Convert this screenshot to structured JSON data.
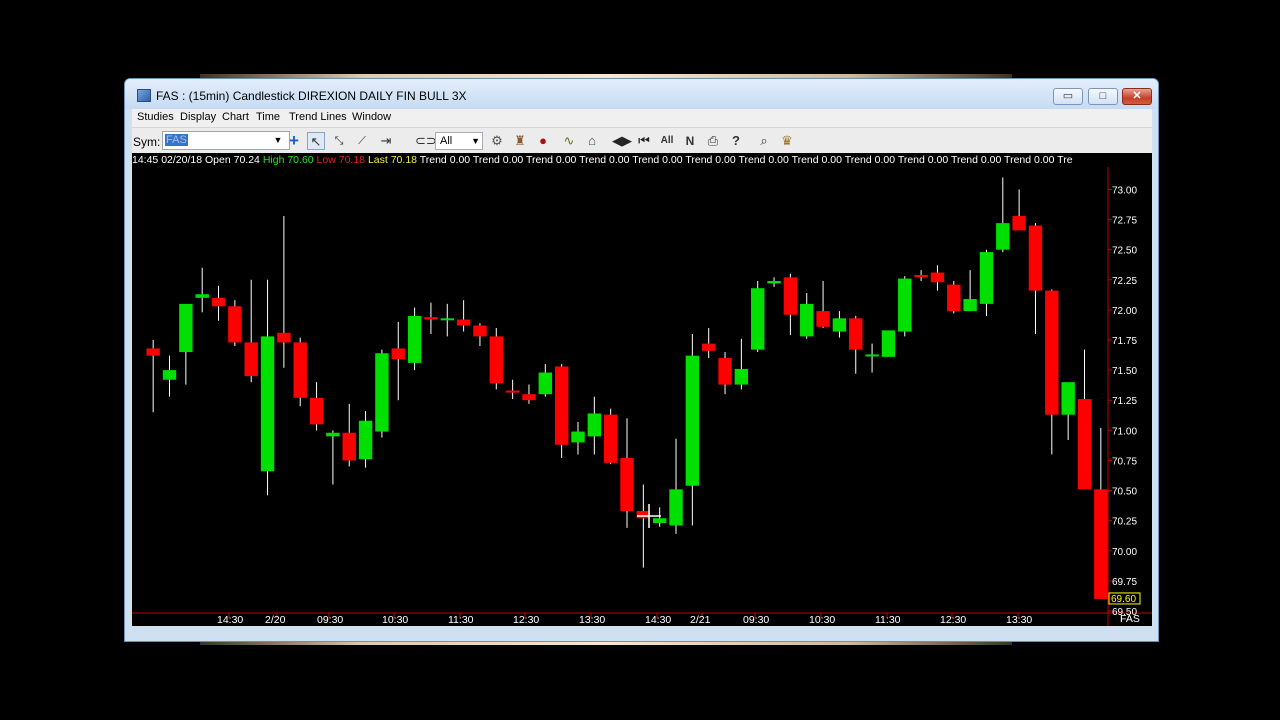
{
  "window": {
    "title": "FAS : (15min) Candlestick  DIREXION DAILY FIN BULL 3X",
    "min_glyph": "▭",
    "max_glyph": "□",
    "close_glyph": "✕"
  },
  "menu": [
    "Studies",
    "Display",
    "Chart",
    "Time",
    "Trend Lines",
    "Window"
  ],
  "toolbar": {
    "sym_label": "Sym:",
    "sym_value": "FAS",
    "range_value": "All",
    "icons": [
      "plus-icon",
      "pointer-icon",
      "crosshair-tool-icon",
      "line-tool-icon",
      "measure-icon",
      "link-icon",
      "gear-icon",
      "stamp-icon",
      "record-icon",
      "wave-icon",
      "building-icon",
      "scroll-left-right-icon",
      "skip-icon",
      "all-text-icon",
      "n-icon",
      "printer-icon",
      "help-icon",
      "search-icon",
      "bag-icon"
    ]
  },
  "status": {
    "time": "14:45",
    "date": "02/20/18",
    "open_label": "Open",
    "open": "70.24",
    "high_label": "High",
    "high": "70.60",
    "low_label": "Low",
    "low": "70.18",
    "last_label": "Last",
    "last": "70.18",
    "trend_text": "Trend 0.00 Trend 0.00 Trend 0.00 Trend 0.00 Trend 0.00 Trend 0.00 Trend 0.00 Trend 0.00 Trend 0.00 Trend 0.00 Trend 0.00 Trend 0.00 Tre"
  },
  "colors": {
    "up": "#00e000",
    "down": "#ff0000",
    "grid": "#c00000",
    "axis_text": "#ffffff",
    "last_box": "#ffff00"
  },
  "chart_data": {
    "type": "candlestick",
    "symbol": "FAS",
    "interval": "15min",
    "ylim": [
      69.5,
      73.12
    ],
    "y_ticks": [
      "73.00",
      "72.75",
      "72.50",
      "72.25",
      "72.00",
      "71.75",
      "71.50",
      "71.25",
      "71.00",
      "70.75",
      "70.50",
      "70.25",
      "70.00",
      "69.75",
      "69.50"
    ],
    "last_price_label": "69.60",
    "x_labels": [
      "14:30",
      "2/20",
      "09:30",
      "10:30",
      "11:30",
      "12:30",
      "13:30",
      "14:30",
      "2/21",
      "09:30",
      "10:30",
      "11:30",
      "12:30",
      "13:30"
    ],
    "axis_symbol": "FAS",
    "candles": [
      [
        71.68,
        71.75,
        71.15,
        71.62
      ],
      [
        71.42,
        71.62,
        71.28,
        71.5
      ],
      [
        71.65,
        71.84,
        71.38,
        72.05
      ],
      [
        72.1,
        72.35,
        71.98,
        72.13
      ],
      [
        72.1,
        72.2,
        71.91,
        72.03
      ],
      [
        72.03,
        72.08,
        71.7,
        71.73
      ],
      [
        71.73,
        72.25,
        71.4,
        71.45
      ],
      [
        70.66,
        72.25,
        70.46,
        71.78
      ],
      [
        71.81,
        72.78,
        71.52,
        71.73
      ],
      [
        71.73,
        71.77,
        71.2,
        71.27
      ],
      [
        71.27,
        71.4,
        71.0,
        71.05
      ],
      [
        70.95,
        71.0,
        70.55,
        70.98
      ],
      [
        70.98,
        71.22,
        70.7,
        70.75
      ],
      [
        70.76,
        71.16,
        70.69,
        71.08
      ],
      [
        70.99,
        71.67,
        70.94,
        71.64
      ],
      [
        71.68,
        71.9,
        71.25,
        71.59
      ],
      [
        71.56,
        72.02,
        71.5,
        71.95
      ],
      [
        71.94,
        72.06,
        71.8,
        71.92
      ],
      [
        71.92,
        72.05,
        71.78,
        71.93
      ],
      [
        71.92,
        72.08,
        71.82,
        71.87
      ],
      [
        71.87,
        71.89,
        71.7,
        71.78
      ],
      [
        71.78,
        71.85,
        71.34,
        71.39
      ],
      [
        71.33,
        71.42,
        71.26,
        71.32
      ],
      [
        71.3,
        71.38,
        71.22,
        71.25
      ],
      [
        71.3,
        71.55,
        71.28,
        71.48
      ],
      [
        71.53,
        71.55,
        70.77,
        70.88
      ],
      [
        70.9,
        71.07,
        70.8,
        70.99
      ],
      [
        70.95,
        71.28,
        70.8,
        71.14
      ],
      [
        71.13,
        71.18,
        70.72,
        70.73
      ],
      [
        70.77,
        71.1,
        70.19,
        70.33
      ],
      [
        70.33,
        70.55,
        69.86,
        70.27
      ],
      [
        70.23,
        70.36,
        70.2,
        70.27
      ],
      [
        70.21,
        70.93,
        70.14,
        70.51
      ],
      [
        70.54,
        71.8,
        70.21,
        71.62
      ],
      [
        71.72,
        71.85,
        71.6,
        71.66
      ],
      [
        71.6,
        71.65,
        71.3,
        71.38
      ],
      [
        71.38,
        71.76,
        71.34,
        71.51
      ],
      [
        71.67,
        72.24,
        71.65,
        72.18
      ],
      [
        72.22,
        72.27,
        72.19,
        72.24
      ],
      [
        72.27,
        72.3,
        71.79,
        71.96
      ],
      [
        71.78,
        72.14,
        71.76,
        72.05
      ],
      [
        71.99,
        72.24,
        71.85,
        71.86
      ],
      [
        71.82,
        71.99,
        71.77,
        71.93
      ],
      [
        71.93,
        71.95,
        71.47,
        71.67
      ],
      [
        71.62,
        71.72,
        71.48,
        71.63
      ],
      [
        71.61,
        71.77,
        71.62,
        71.83
      ],
      [
        71.82,
        72.28,
        71.78,
        72.26
      ],
      [
        72.29,
        72.33,
        72.24,
        72.27
      ],
      [
        72.31,
        72.37,
        72.16,
        72.23
      ],
      [
        72.21,
        72.24,
        71.97,
        71.99
      ],
      [
        71.99,
        72.33,
        71.99,
        72.09
      ],
      [
        72.05,
        72.5,
        71.95,
        72.48
      ],
      [
        72.5,
        73.1,
        72.48,
        72.72
      ],
      [
        72.78,
        73.0,
        72.68,
        72.66
      ],
      [
        72.7,
        72.72,
        71.8,
        72.16
      ],
      [
        72.16,
        72.17,
        70.8,
        71.13
      ],
      [
        71.13,
        71.34,
        70.92,
        71.4
      ],
      [
        71.26,
        71.67,
        70.57,
        70.51
      ],
      [
        70.51,
        71.02,
        69.66,
        69.6
      ]
    ]
  }
}
